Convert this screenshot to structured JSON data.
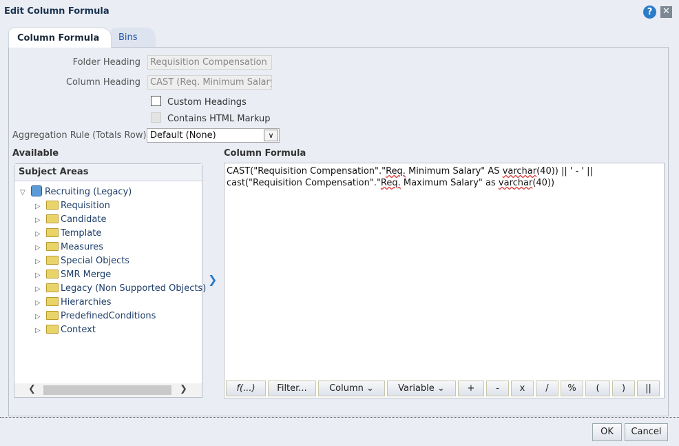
{
  "dialog": {
    "title": "Edit Column Formula",
    "help_icon": "?",
    "close_icon": "✕"
  },
  "tabs": [
    {
      "label": "Column Formula",
      "active": true
    },
    {
      "label": "Bins",
      "active": false
    }
  ],
  "form": {
    "folder_heading_label": "Folder Heading",
    "folder_heading_value": "Requisition Compensation",
    "column_heading_label": "Column Heading",
    "column_heading_value": "CAST (Req. Minimum Salary",
    "custom_headings_label": "Custom Headings",
    "custom_headings_checked": false,
    "html_markup_label": "Contains HTML Markup",
    "html_markup_checked": false,
    "aggregation_label": "Aggregation Rule (Totals Row)",
    "aggregation_value": "Default (None)"
  },
  "available": {
    "heading": "Available",
    "panel_title": "Subject Areas",
    "root": "Recruiting (Legacy)",
    "folders": [
      "Requisition",
      "Candidate",
      "Template",
      "Measures",
      "Special Objects",
      "SMR Merge",
      "Legacy (Non Supported Objects)",
      "Hierarchies",
      "PredefinedConditions",
      "Context"
    ]
  },
  "formula": {
    "heading": "Column Formula",
    "parts": [
      "CAST(\"Requisition Compensation\".\"",
      "Req.",
      "  Minimum Salary\" AS ",
      "varchar",
      "(40)) || ' - ' || cast(\"Requisition Compensation\".\"",
      "Req.",
      "  Maximum Salary\" as ",
      "varchar",
      "(40))"
    ],
    "buttons": [
      "f(...)",
      "Filter...",
      "Column ⌄",
      "Variable ⌄",
      "+",
      "-",
      "x",
      "/",
      "%",
      "(",
      ")",
      "||"
    ]
  },
  "footer": {
    "ok": "OK",
    "cancel": "Cancel"
  }
}
